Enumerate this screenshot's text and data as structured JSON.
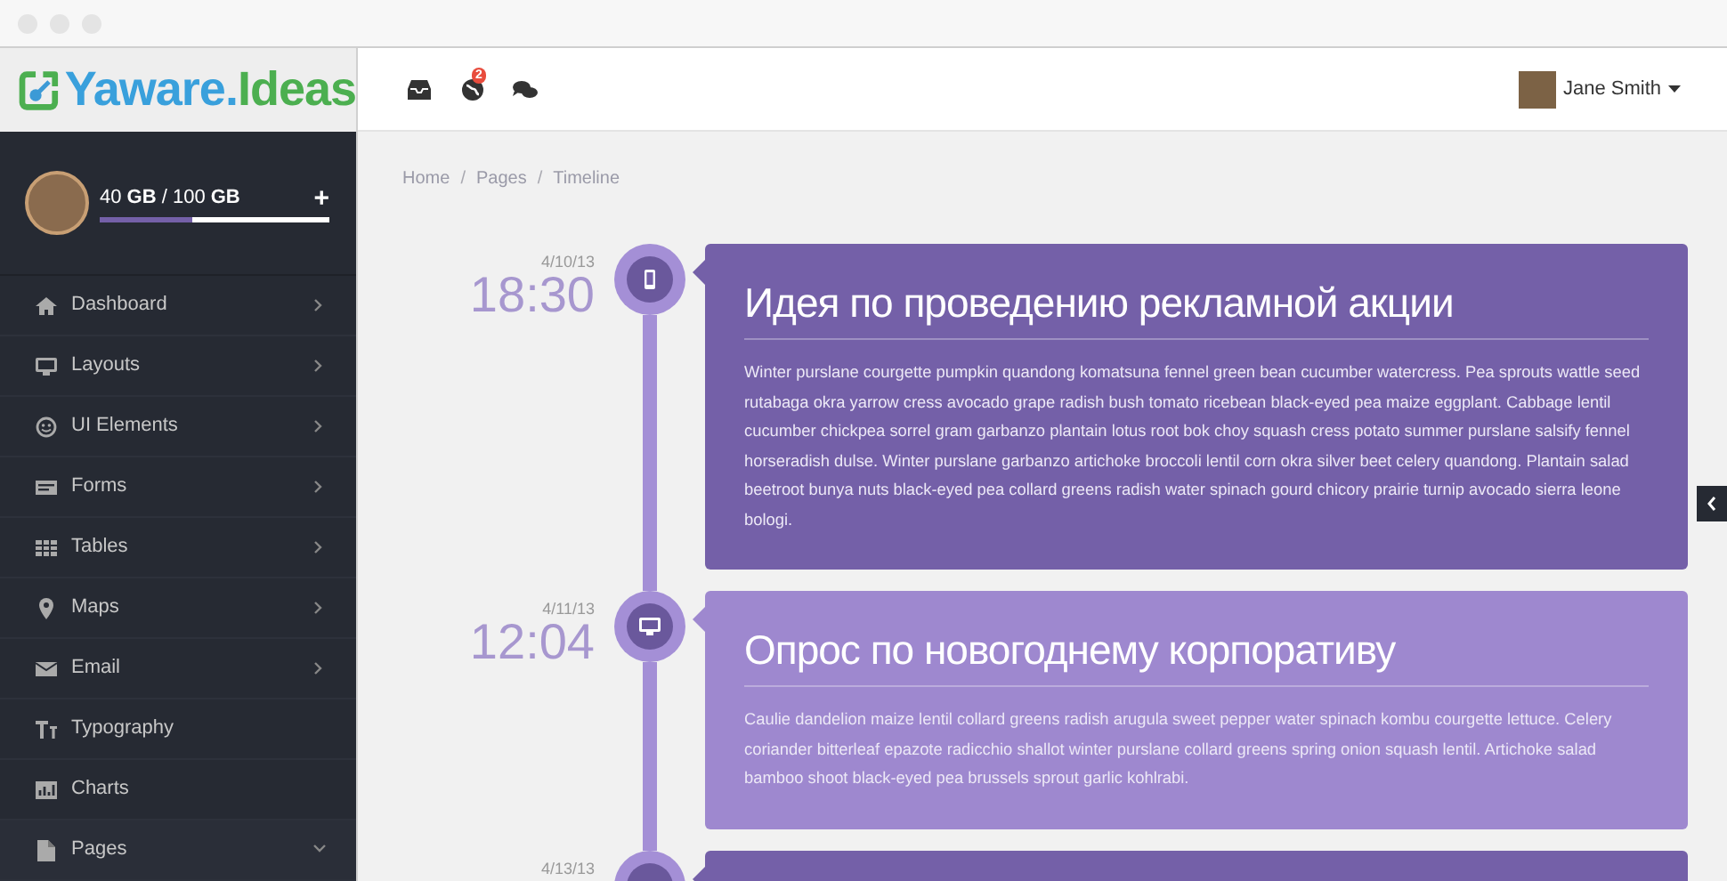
{
  "brand": {
    "name": "Yaware.Ideas"
  },
  "header": {
    "notification_badge": "2",
    "user_name": "Jane Smith"
  },
  "storage": {
    "text": "40 **GB** / 100 **GB**",
    "level": 0.4,
    "add_label": "+"
  },
  "sidebar": {
    "items": [
      {
        "label": "Dashboard",
        "has_submenu": true,
        "expanded": false
      },
      {
        "label": "Layouts",
        "has_submenu": true,
        "expanded": false
      },
      {
        "label": "UI Elements",
        "has_submenu": true,
        "expanded": false
      },
      {
        "label": "Forms",
        "has_submenu": true,
        "expanded": false
      },
      {
        "label": "Tables",
        "has_submenu": true,
        "expanded": false
      },
      {
        "label": "Maps",
        "has_submenu": true,
        "expanded": false
      },
      {
        "label": "Email",
        "has_submenu": true,
        "expanded": false
      },
      {
        "label": "Typography",
        "has_submenu": false
      },
      {
        "label": "Charts",
        "has_submenu": false
      },
      {
        "label": "Pages",
        "has_submenu": true,
        "expanded": true
      }
    ]
  },
  "breadcrumbs": [
    {
      "label": "Home"
    },
    {
      "separator": "/",
      "label": "Pages"
    },
    {
      "separator": "/",
      "label": "Timeline"
    }
  ],
  "timeline": [
    {
      "date": "4/10/13",
      "time": "18:30",
      "color": "#7460a8",
      "title": "Идея по проведению рекламной акции",
      "body": "Winter purslane courgette pumpkin quandong komatsuna fennel green bean cucumber watercress. Pea sprouts wattle seed rutabaga okra yarrow cress avocado grape radish bush tomato ricebean black-eyed pea maize eggplant. Cabbage lentil cucumber chickpea sorrel gram garbanzo plantain lotus root bok choy squash cress potato summer purslane salsify fennel horseradish dulse. Winter purslane garbanzo artichoke broccoli lentil corn okra silver beet celery quandong. Plantain salad beetroot bunya nuts black-eyed pea collard greens radish water spinach gourd chicory prairie turnip avocado sierra leone bologi."
    },
    {
      "date": "4/11/13",
      "time": "12:04",
      "color": "#9e88cf",
      "title": "Опрос по новогоднему корпоративу",
      "body": "Caulie dandelion maize lentil collard greens radish arugula sweet pepper water spinach kombu courgette lettuce. Celery coriander bitterleaf epazote radicchio shallot winter purslane collard greens spring onion squash lentil. Artichoke salad bamboo shoot black-eyed pea brussels sprout garlic kohlrabi."
    },
    {
      "date": "4/13/13",
      "color": "#7460a8"
    }
  ]
}
